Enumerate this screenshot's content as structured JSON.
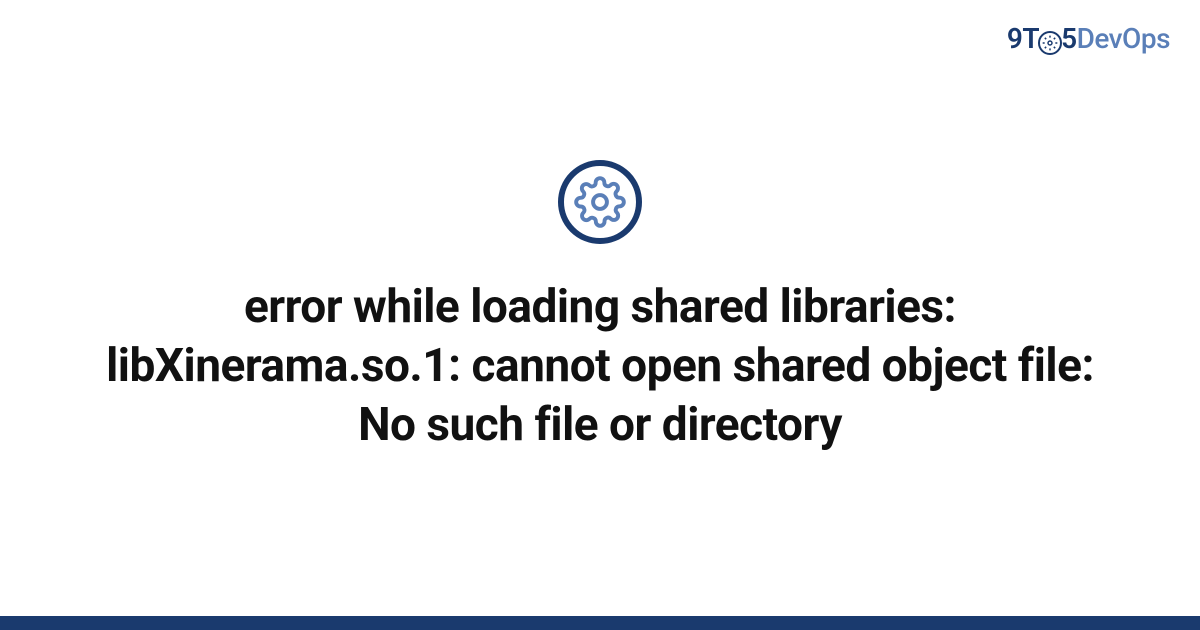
{
  "brand": {
    "part1": "9T",
    "part2": "5",
    "part3": "DevOps"
  },
  "title": "error while loading shared libraries: libXinerama.so.1: cannot open shared object file: No such file or directory",
  "colors": {
    "primary": "#1a3a6e",
    "secondary": "#5a7fb8"
  }
}
